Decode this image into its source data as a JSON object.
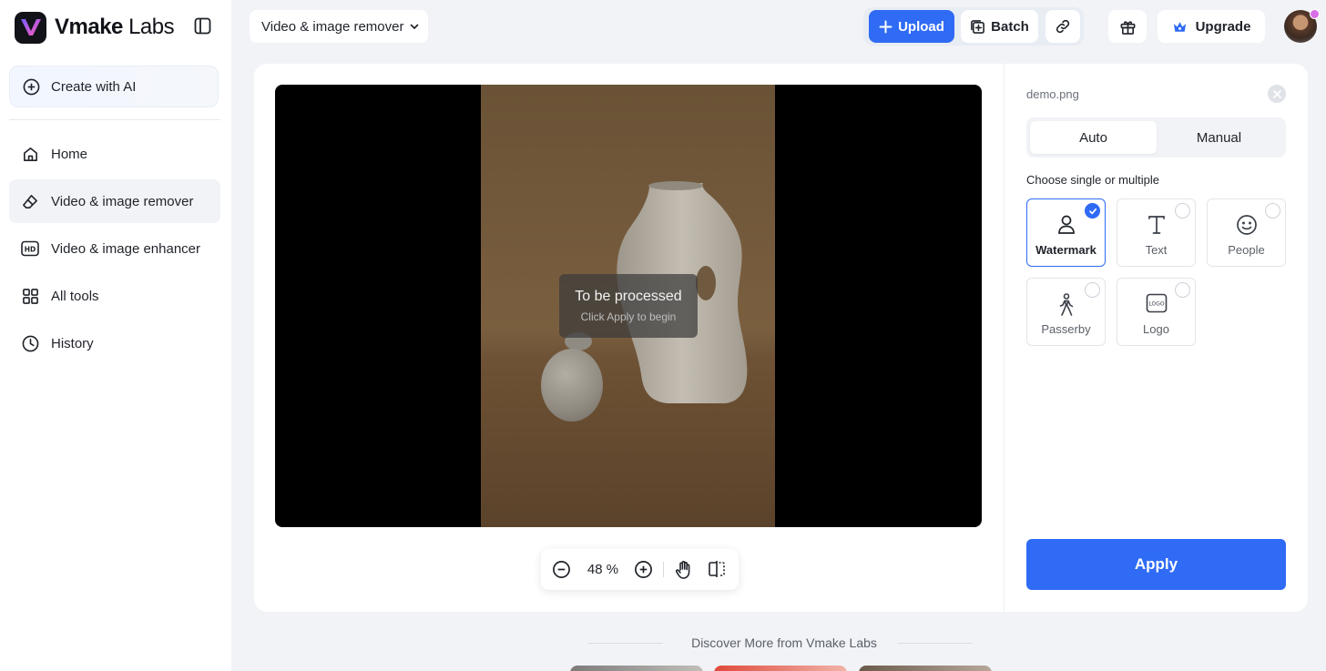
{
  "brand": {
    "name_bold": "Vmake",
    "name_light": "Labs"
  },
  "sidebar": {
    "create_label": "Create with AI",
    "items": [
      {
        "label": "Home",
        "icon": "home-icon"
      },
      {
        "label": "Video & image remover",
        "icon": "eraser-icon",
        "active": true
      },
      {
        "label": "Video & image enhancer",
        "icon": "hd-icon"
      },
      {
        "label": "All tools",
        "icon": "grid-icon"
      },
      {
        "label": "History",
        "icon": "clock-icon"
      }
    ]
  },
  "header": {
    "tool_select": "Video & image remover",
    "upload_label": "Upload",
    "batch_label": "Batch",
    "upgrade_label": "Upgrade"
  },
  "preview": {
    "status_title": "To be processed",
    "status_sub": "Click Apply to begin",
    "zoom": "48 %"
  },
  "panel": {
    "file_name": "demo.png",
    "tabs": [
      "Auto",
      "Manual"
    ],
    "active_tab": "Auto",
    "choose_label": "Choose single or multiple",
    "options": [
      {
        "label": "Watermark",
        "icon": "watermark-person-icon",
        "selected": true
      },
      {
        "label": "Text",
        "icon": "text-icon",
        "selected": false
      },
      {
        "label": "People",
        "icon": "smiley-icon",
        "selected": false
      },
      {
        "label": "Passerby",
        "icon": "walking-person-icon",
        "selected": false
      },
      {
        "label": "Logo",
        "icon": "logo-icon",
        "selected": false
      }
    ],
    "apply_label": "Apply"
  },
  "footer": {
    "discover": "Discover More from Vmake Labs"
  },
  "colors": {
    "accent": "#2f6bf5",
    "background": "#f1f3f7"
  }
}
